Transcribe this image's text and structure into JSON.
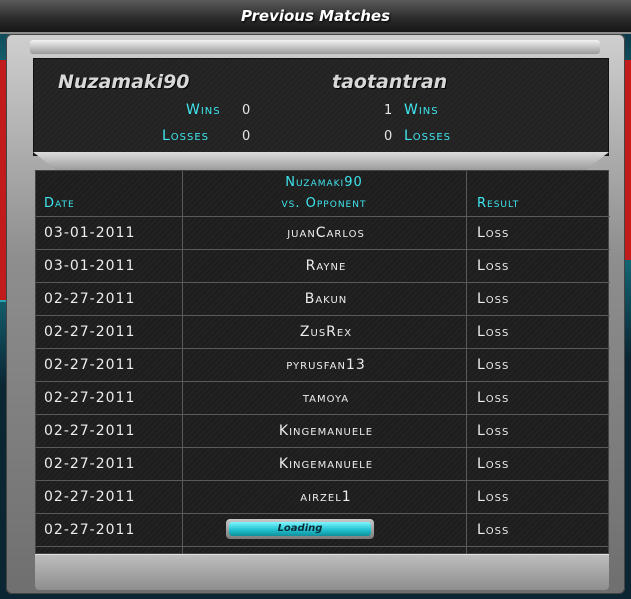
{
  "title": "Previous Matches",
  "player": {
    "name": "Nuzamaki90",
    "wins_label": "Wins",
    "wins": "0",
    "losses_label": "Losses",
    "losses": "0"
  },
  "opponent": {
    "name": "taotantran",
    "wins_label": "Wins",
    "wins": "1",
    "losses_label": "Losses",
    "losses": "0"
  },
  "table": {
    "col_date": "Date",
    "col_opponent_line1": "Nuzamaki90",
    "col_opponent_line2": "vs. Opponent",
    "col_result": "Result",
    "rows": [
      {
        "date": "03-01-2011",
        "opponent": "juanCarlos",
        "result": "Loss"
      },
      {
        "date": "03-01-2011",
        "opponent": "Rayne",
        "result": "Loss"
      },
      {
        "date": "02-27-2011",
        "opponent": "Bakun",
        "result": "Loss"
      },
      {
        "date": "02-27-2011",
        "opponent": "ZusRex",
        "result": "Loss"
      },
      {
        "date": "02-27-2011",
        "opponent": "pyrusfan13",
        "result": "Loss"
      },
      {
        "date": "02-27-2011",
        "opponent": "tamoya",
        "result": "Loss"
      },
      {
        "date": "02-27-2011",
        "opponent": "Kingemanuele",
        "result": "Loss"
      },
      {
        "date": "02-27-2011",
        "opponent": "Kingemanuele",
        "result": "Loss"
      },
      {
        "date": "02-27-2011",
        "opponent": "airzel1",
        "result": "Loss"
      },
      {
        "date": "02-27-2011",
        "opponent": "",
        "result": "Loss"
      }
    ],
    "loading_label": "Loading"
  },
  "colors": {
    "accent": "#3fe6ee",
    "text": "#ededed",
    "frame": "#9b9b9b"
  }
}
